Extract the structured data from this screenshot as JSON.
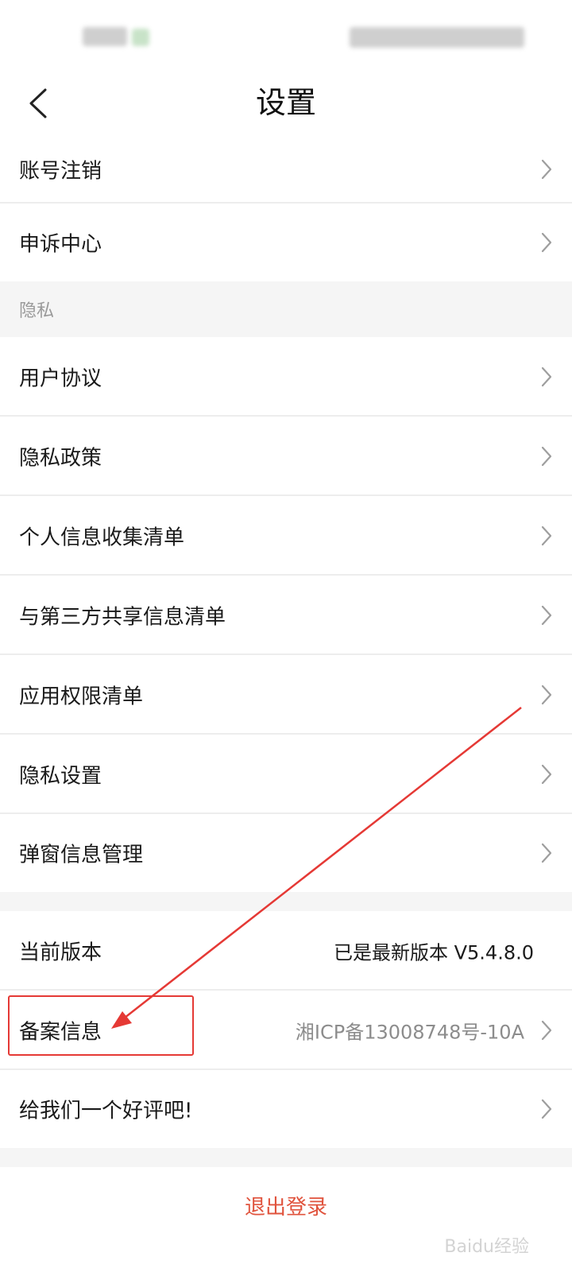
{
  "header": {
    "title": "设置"
  },
  "rows_top": [
    {
      "label": "账号注销"
    },
    {
      "label": "申诉中心"
    }
  ],
  "privacy_section": {
    "title": "隐私",
    "items": [
      {
        "label": "用户协议"
      },
      {
        "label": "隐私政策"
      },
      {
        "label": "个人信息收集清单"
      },
      {
        "label": "与第三方共享信息清单"
      },
      {
        "label": "应用权限清单"
      },
      {
        "label": "隐私设置"
      },
      {
        "label": "弹窗信息管理"
      }
    ]
  },
  "about_section": {
    "version": {
      "label": "当前版本",
      "value": "已是最新版本 V5.4.8.0"
    },
    "record": {
      "label": "备案信息",
      "value": "湘ICP备13008748号-10A"
    },
    "review": {
      "label": "给我们一个好评吧!"
    }
  },
  "logout": {
    "label": "退出登录"
  },
  "watermark": {
    "text": "Baidu经验"
  },
  "colors": {
    "accent_red": "#e0533d",
    "annotation_red": "#e53935",
    "background": "#f5f5f5"
  },
  "icons": [
    "chevron-left-icon",
    "chevron-right-icon"
  ]
}
